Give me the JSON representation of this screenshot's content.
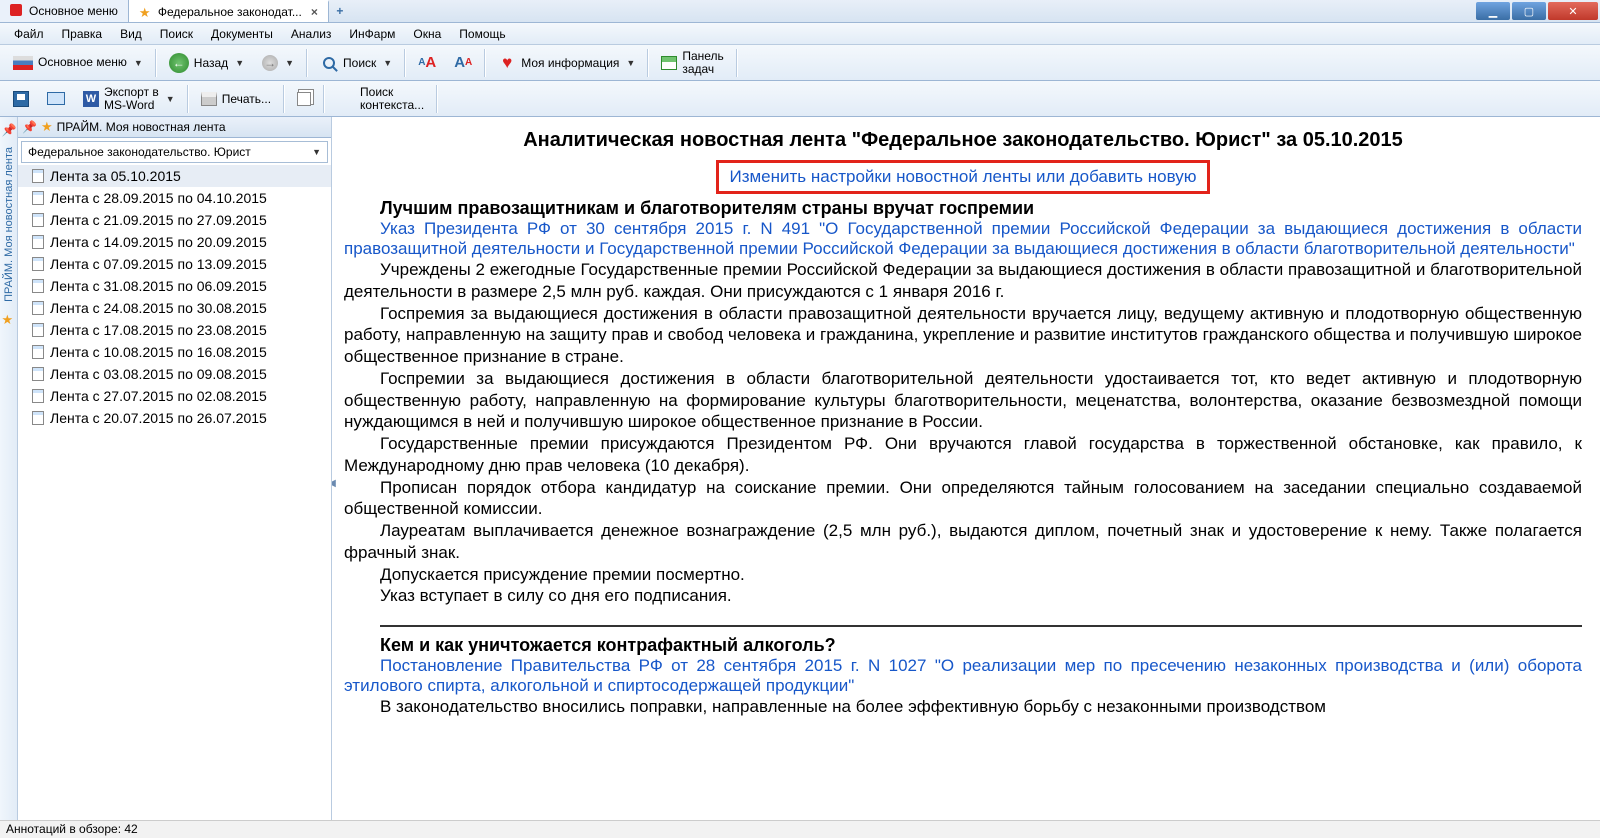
{
  "tabs": {
    "main": "Основное меню",
    "active": "Федеральное законодат..."
  },
  "menu": [
    "Файл",
    "Правка",
    "Вид",
    "Поиск",
    "Документы",
    "Анализ",
    "ИнФарм",
    "Окна",
    "Помощь"
  ],
  "tb1": {
    "main": "Основное меню",
    "back": "Назад",
    "search": "Поиск",
    "info": "Моя информация",
    "panel1": "Панель",
    "panel2": "задач"
  },
  "tb2": {
    "export1": "Экспорт в",
    "export2": "MS-Word",
    "print": "Печать...",
    "ctx1": "Поиск",
    "ctx2": "контекста..."
  },
  "tree": {
    "header": "ПРАЙМ. Моя новостная лента",
    "rail": "ПРАЙМ. Моя новостная лента",
    "dd": "Федеральное законодательство. Юрист",
    "items": [
      "Лента за 05.10.2015",
      "Лента с 28.09.2015 по 04.10.2015",
      "Лента с 21.09.2015 по 27.09.2015",
      "Лента с 14.09.2015 по 20.09.2015",
      "Лента с 07.09.2015 по 13.09.2015",
      "Лента с 31.08.2015 по 06.09.2015",
      "Лента с 24.08.2015 по 30.08.2015",
      "Лента с 17.08.2015 по 23.08.2015",
      "Лента с 10.08.2015 по 16.08.2015",
      "Лента с 03.08.2015 по 09.08.2015",
      "Лента с 27.07.2015 по 02.08.2015",
      "Лента с 20.07.2015 по 26.07.2015"
    ]
  },
  "doc": {
    "title": "Аналитическая новостная лента \"Федеральное законодательство. Юрист\" за 05.10.2015",
    "settings": "Изменить настройки новостной ленты или добавить новую",
    "a1": {
      "h": "Лучшим правозащитникам и благотворителям страны вручат госпремии",
      "link": "Указ Президента РФ от 30 сентября 2015 г. N 491 \"О Государственной премии Российской Федерации за выдающиеся достижения в области правозащитной деятельности и Государственной премии Российской Федерации за выдающиеся достижения в области благотворительной деятельности\"",
      "p1": "Учреждены 2 ежегодные Государственные премии Российской Федерации за выдающиеся достижения в области правозащитной и благотворительной деятельности в размере 2,5 млн руб. каждая. Они присуждаются с 1 января 2016 г.",
      "p2": "Госпремия за выдающиеся достижения в области правозащитной деятельности вручается лицу, ведущему активную и плодотворную общественную работу, направленную на защиту прав и свобод человека и гражданина, укрепление и развитие институтов гражданского общества и получившую широкое общественное признание в стране.",
      "p3": "Госпремии за выдающиеся достижения в области благотворительной деятельности удостаивается тот, кто ведет активную и плодотворную общественную работу, направленную на формирование культуры благотворительности, меценатства, волонтерства, оказание безвозмездной помощи нуждающимся в ней и получившую широкое общественное признание в России.",
      "p4": "Государственные премии присуждаются Президентом РФ. Они вручаются главой государства в торжественной обстановке, как правило, к Международному дню прав человека (10 декабря).",
      "p5": "Прописан порядок отбора кандидатур на соискание премии. Они определяются тайным голосованием на заседании специально создаваемой общественной комиссии.",
      "p6": "Лауреатам выплачивается денежное вознаграждение (2,5 млн руб.), выдаются диплом, почетный знак и удостоверение к нему. Также полагается фрачный знак.",
      "p7": "Допускается присуждение премии посмертно.",
      "p8": "Указ вступает в силу со дня его подписания."
    },
    "a2": {
      "h": "Кем и как уничтожается контрафактный алкоголь?",
      "link": "Постановление Правительства РФ от 28 сентября 2015 г. N 1027 \"О реализации мер по пресечению незаконных производства и (или) оборота этилового спирта, алкогольной и спиртосодержащей продукции\"",
      "p1": "В законодательство вносились поправки, направленные на более эффективную борьбу с незаконными производством"
    }
  },
  "status": "Аннотаций в обзоре: 42"
}
